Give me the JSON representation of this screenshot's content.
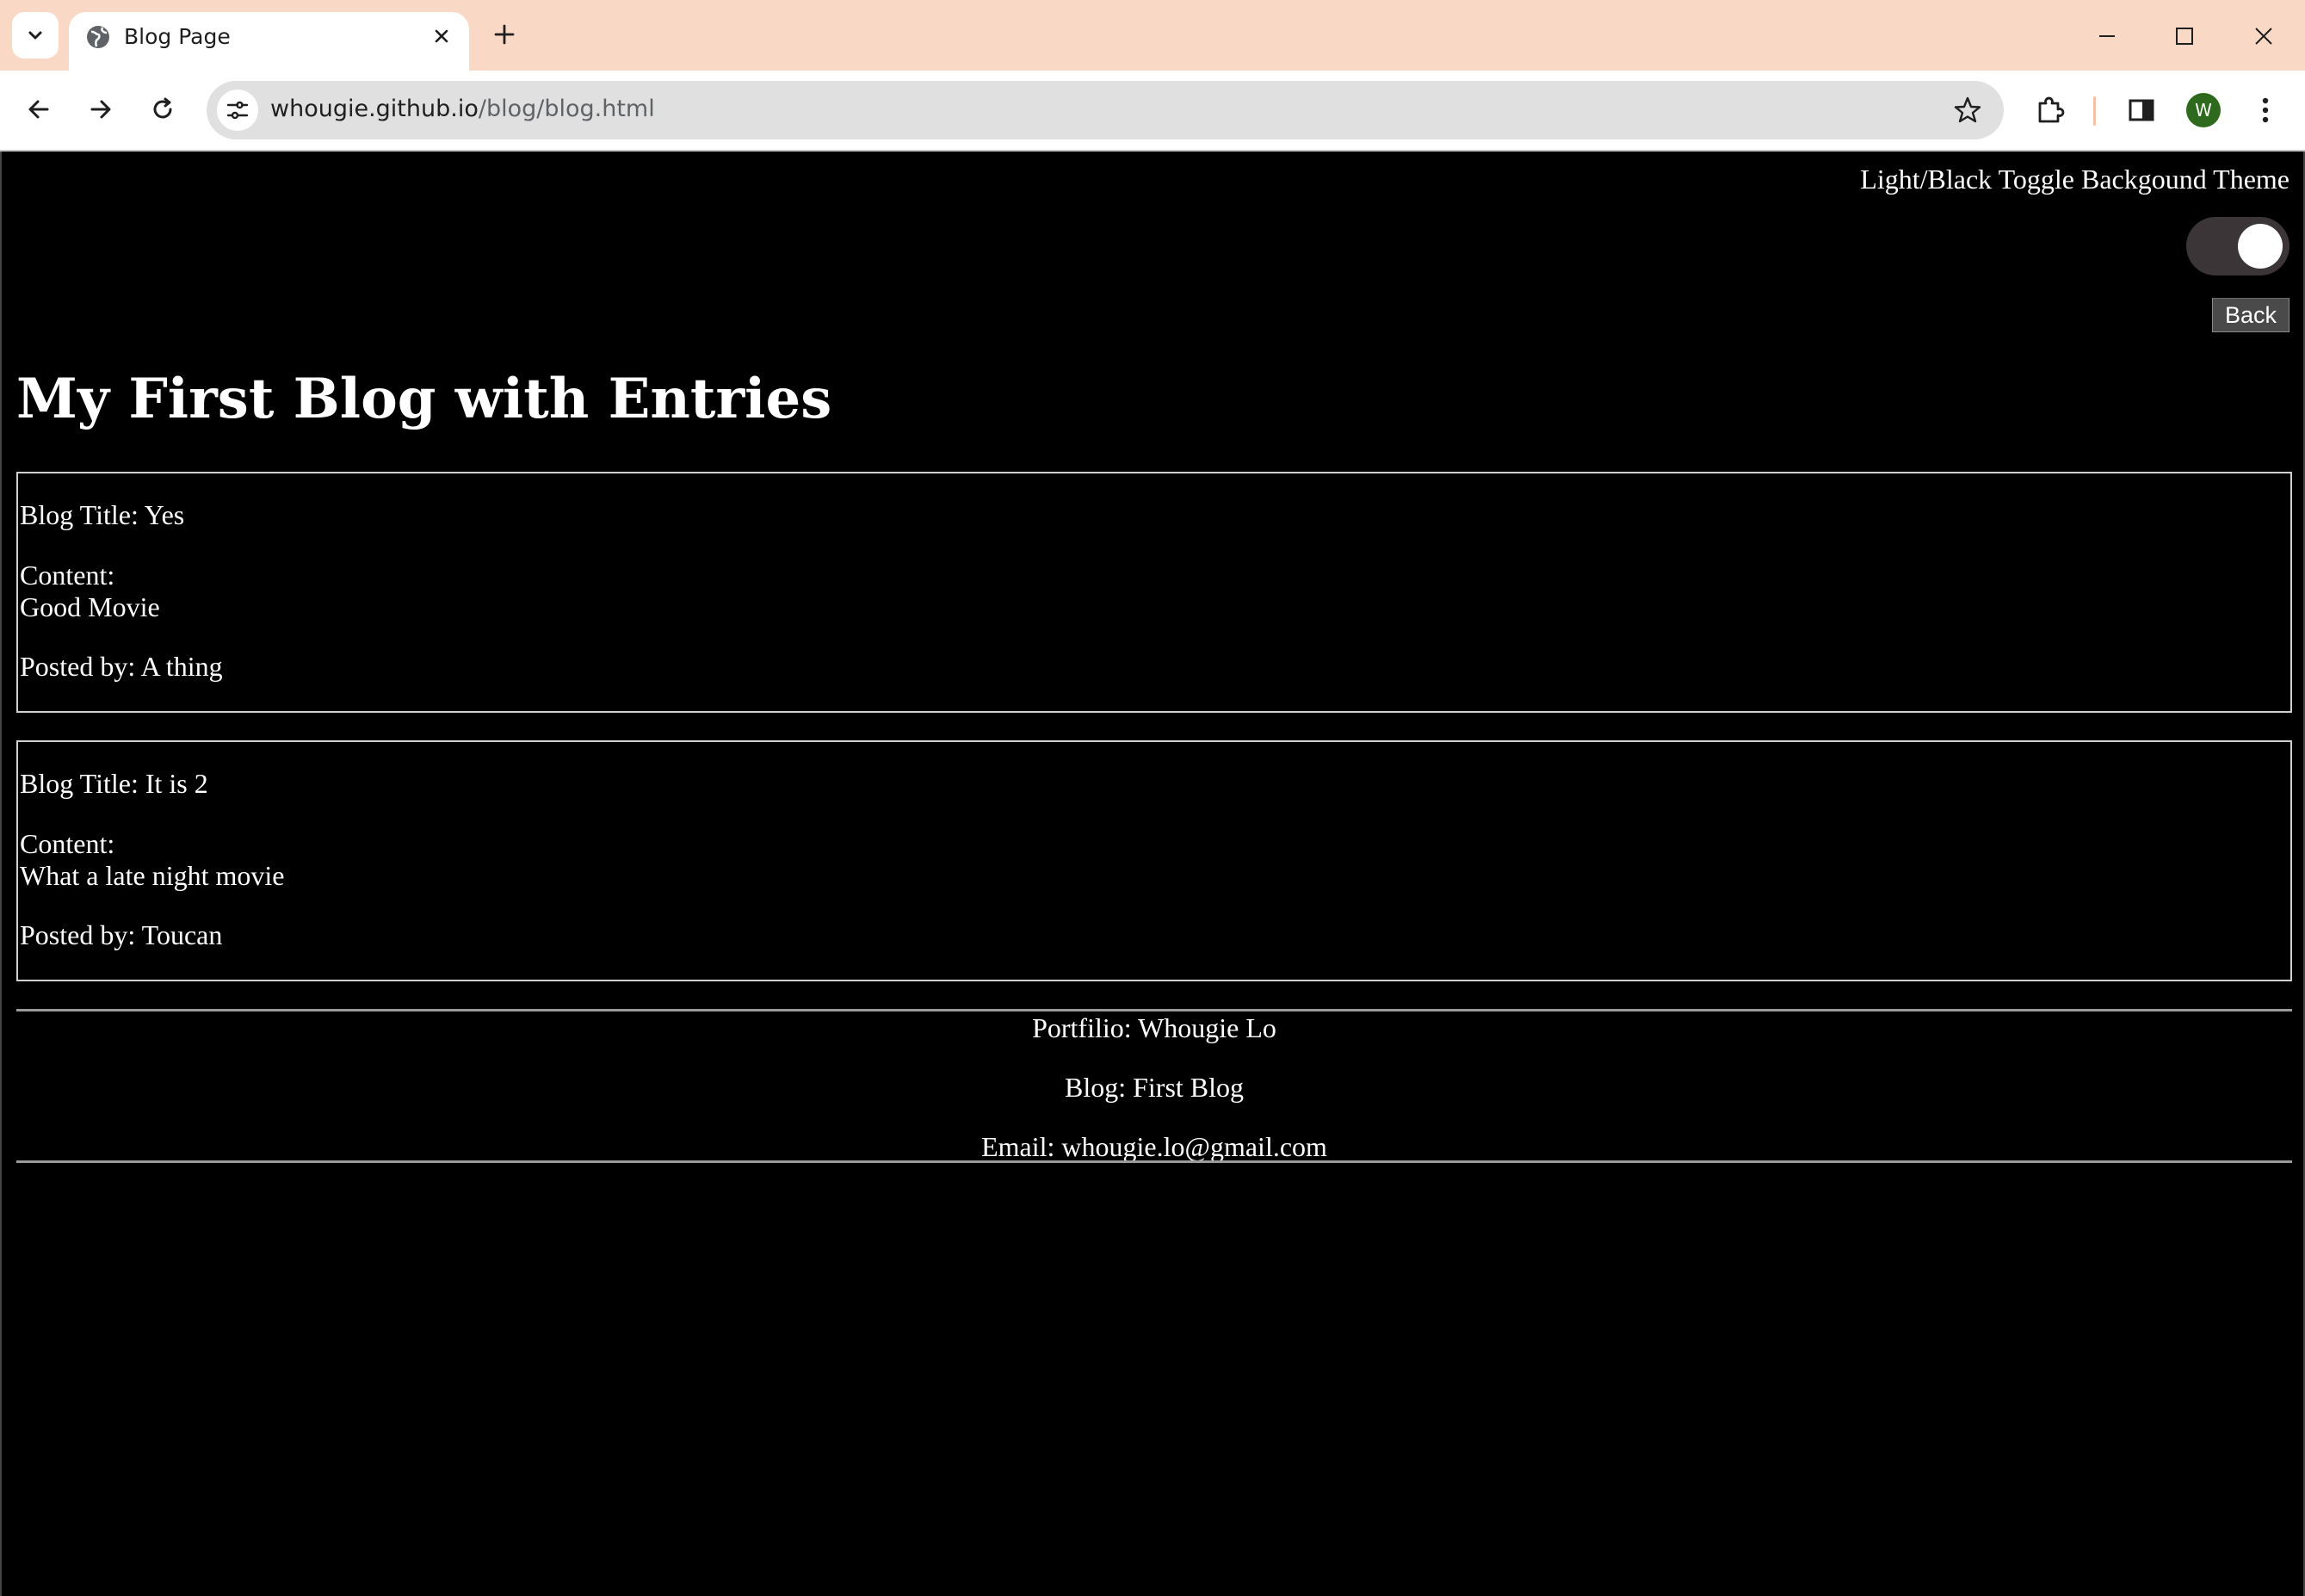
{
  "browser": {
    "tab": {
      "title": "Blog Page"
    },
    "address": {
      "domain": "whougie.github.io",
      "path": "/blog/blog.html"
    },
    "profile_initial": "W"
  },
  "page": {
    "toggle_label": "Light/Black Toggle Backgound Theme",
    "toggle_state": "on",
    "back_label": "Back",
    "title": "My First Blog with Entries",
    "entries": [
      {
        "title_line": "Blog Title: Yes",
        "content_label": "Content:",
        "content": "Good Movie",
        "author_line": "Posted by: A thing"
      },
      {
        "title_line": "Blog Title: It is 2",
        "content_label": "Content:",
        "content": "What a late night movie",
        "author_line": "Posted by: Toucan"
      }
    ],
    "footer": {
      "portfolio": "Portfilio: Whougie Lo",
      "blog": "Blog: First Blog",
      "email": "Email: whougie.lo@gmail.com"
    }
  },
  "colors": {
    "tabstrip": "#fad8c6",
    "page_background": "#000000",
    "toggle_track": "#3b3537",
    "profile": "#2d6a1d"
  }
}
